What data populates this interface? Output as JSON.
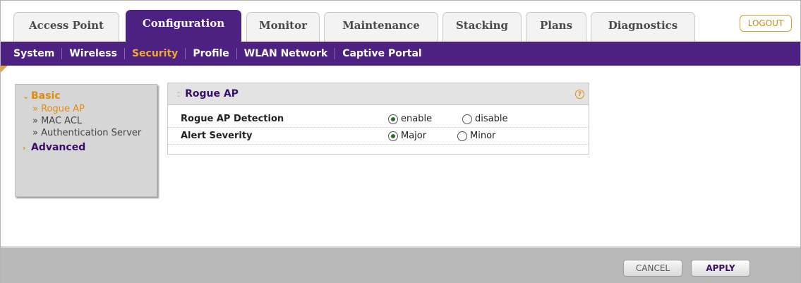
{
  "tabs": [
    {
      "label": "Access Point",
      "active": false
    },
    {
      "label": "Configuration",
      "active": true
    },
    {
      "label": "Monitor",
      "active": false
    },
    {
      "label": "Maintenance",
      "active": false
    },
    {
      "label": "Stacking",
      "active": false
    },
    {
      "label": "Plans",
      "active": false
    },
    {
      "label": "Diagnostics",
      "active": false
    }
  ],
  "logout_label": "LOGOUT",
  "subnav": [
    {
      "label": "System",
      "active": false
    },
    {
      "label": "Wireless",
      "active": false
    },
    {
      "label": "Security",
      "active": true
    },
    {
      "label": "Profile",
      "active": false
    },
    {
      "label": "WLAN Network",
      "active": false
    },
    {
      "label": "Captive Portal",
      "active": false
    }
  ],
  "sidebar": {
    "basic_label": "Basic",
    "items": [
      {
        "label": "» Rogue AP",
        "active": true
      },
      {
        "label": "» MAC ACL",
        "active": false
      },
      {
        "label": "» Authentication Server",
        "active": false
      }
    ],
    "advanced_label": "Advanced"
  },
  "panel": {
    "title": "Rogue AP",
    "help_icon": "?",
    "rows": [
      {
        "label": "Rogue AP Detection",
        "options": [
          "enable",
          "disable"
        ],
        "selected": "enable"
      },
      {
        "label": "Alert Severity",
        "options": [
          "Major",
          "Minor"
        ],
        "selected": "Major"
      }
    ]
  },
  "footer": {
    "cancel_label": "CANCEL",
    "apply_label": "APPLY"
  },
  "colors": {
    "brand_purple": "#4d2182",
    "accent_orange": "#e08c0f"
  }
}
